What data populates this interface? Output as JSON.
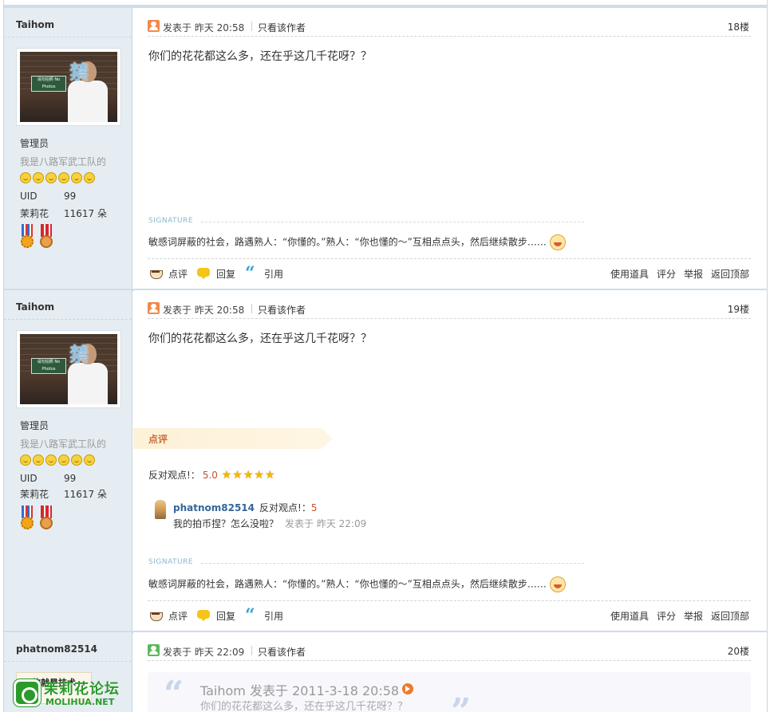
{
  "posts": [
    {
      "author": {
        "username": "Taihom",
        "avatar": {
          "ban_char": "禁",
          "sign_text": "请勿拍照 No Photos"
        },
        "role": "管理员",
        "title": "我是八路军武工队的",
        "rank_icon_count": 6,
        "uid_label": "UID",
        "uid": "99",
        "flowers_label": "茉莉花",
        "flowers": "11617 朵"
      },
      "meta": {
        "posted": "发表于 昨天 20:58",
        "only_author": "只看该作者",
        "floor": "18楼",
        "icon_color": "#f08a4b"
      },
      "content": "你们的花花都这么多，还在乎这几千花呀？？",
      "signature_label": "SIGNATURE",
      "signature": "敏感词屏蔽的社会，路遇熟人：“你懂的。”熟人：“你也懂的～”互相点点头，然后继续散步……",
      "actions": {
        "comment": "点评",
        "reply": "回复",
        "quote": "引用",
        "right": [
          "使用道具",
          "评分",
          "举报",
          "返回顶部"
        ]
      }
    },
    {
      "author": {
        "username": "Taihom",
        "avatar": {
          "ban_char": "禁",
          "sign_text": "请勿拍照 No Photos"
        },
        "role": "管理员",
        "title": "我是八路军武工队的",
        "rank_icon_count": 6,
        "uid_label": "UID",
        "uid": "99",
        "flowers_label": "茉莉花",
        "flowers": "11617 朵"
      },
      "meta": {
        "posted": "发表于 昨天 20:58",
        "only_author": "只看该作者",
        "floor": "19楼",
        "icon_color": "#f08a4b"
      },
      "content": "你们的花花都这么多，还在乎这几千花呀？？",
      "rating": {
        "banner": "点评",
        "label": "反对观点!：",
        "score": "5.0",
        "stars": 5,
        "comment": {
          "user": "phatnom82514",
          "opinion": "反对观点!：",
          "opinion_score": "5",
          "text": "我的拍币捏？怎么没啦？",
          "time": "发表于 昨天 22:09"
        }
      },
      "signature_label": "SIGNATURE",
      "signature": "敏感词屏蔽的社会，路遇熟人：“你懂的。”熟人：“你也懂的～”互相点点头，然后继续散步……",
      "actions": {
        "comment": "点评",
        "reply": "回复",
        "quote": "引用",
        "right": [
          "使用道具",
          "评分",
          "举报",
          "返回顶部"
        ]
      }
    },
    {
      "author": {
        "username": "phatnom82514",
        "avatar_text": "玩的就是技术"
      },
      "meta": {
        "posted": "发表于 昨天 22:09",
        "only_author": "只看该作者",
        "floor": "20楼",
        "icon_color": "#5cb85c"
      },
      "quote": {
        "head": "Taihom 发表于 2011-3-18 20:58",
        "body": "你们的花花都这么多，还在乎这几千花呀？？"
      }
    }
  ],
  "watermark": {
    "name": "茉莉花论坛",
    "url": "MOLIHUA.NET"
  }
}
